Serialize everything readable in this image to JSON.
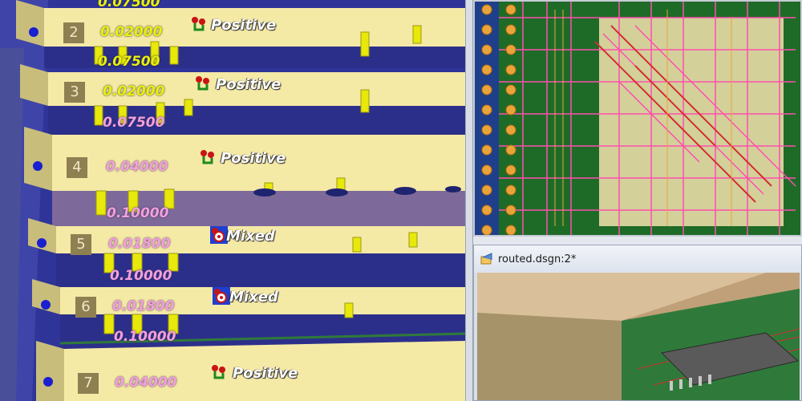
{
  "stackup": {
    "layers": [
      {
        "number": "2",
        "thickness": "0.02000",
        "plane_type": "Positive",
        "plane_icon": "positive-plane-icon",
        "top_value": "0.07500"
      },
      {
        "number": "3",
        "thickness": "0.02000",
        "plane_type": "Positive",
        "plane_icon": "positive-plane-icon",
        "dielectric_below": "0.07500",
        "dielectric_above": "0.07500"
      },
      {
        "number": "4",
        "thickness": "0.04000",
        "plane_type": "Positive",
        "plane_icon": "positive-plane-icon",
        "dielectric_below": "0.10000"
      },
      {
        "number": "5",
        "thickness": "0.01800",
        "plane_type": "Mixed",
        "plane_icon": "mixed-plane-icon",
        "dielectric_below": "0.10000"
      },
      {
        "number": "6",
        "thickness": "0.01800",
        "plane_type": "Mixed",
        "plane_icon": "mixed-plane-icon",
        "dielectric_below": "0.10000"
      },
      {
        "number": "7",
        "thickness": "0.04000",
        "plane_type": "Positive",
        "plane_icon": "positive-plane-icon"
      }
    ]
  },
  "routed_window": {
    "title": "routed.dsgn:2*",
    "icon": "design-file-icon"
  },
  "colors": {
    "copper_layer": "#f5e9a6",
    "dielectric": "#2f3598",
    "via": "#e8e80a",
    "pcb_green": "#1e6b28",
    "trace_pink": "#ff4fae"
  }
}
